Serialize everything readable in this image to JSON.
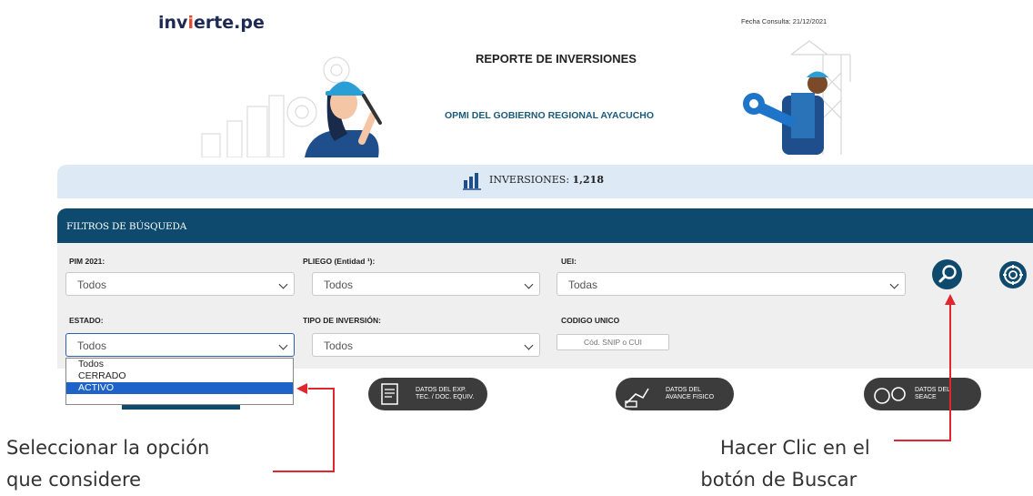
{
  "header": {
    "logo_pre": "inv",
    "logo_caret": "i",
    "logo_post": "erte.pe",
    "fecha": "Fecha Consulta: 21/12/2021",
    "title": "REPORTE DE INVERSIONES",
    "subtitle": "OPMI DEL GOBIERNO REGIONAL AYACUCHO"
  },
  "summary": {
    "label": "INVERSIONES:",
    "count": "1,218"
  },
  "filters": {
    "title": "FILTROS DE BÚSQUEDA",
    "pim": {
      "label": "PIM 2021:",
      "value": "Todos"
    },
    "pliego": {
      "label": "PLIEGO (Entidad ¹):",
      "value": "Todos"
    },
    "uei": {
      "label": "UEI:",
      "value": "Todas"
    },
    "estado": {
      "label": "ESTADO:",
      "value": "Todos",
      "options": [
        "Todos",
        "CERRADO",
        "ACTIVO"
      ],
      "highlighted": "ACTIVO"
    },
    "tipo": {
      "label": "TIPO DE INVERSIÓN:",
      "value": "Todos"
    },
    "codigo": {
      "label": "CODIGO UNICO",
      "placeholder": "Cód. SNIP o CUI"
    }
  },
  "cards": [
    {
      "line1": "DATOS DEL EXP.",
      "line2": "TEC. / DOC. EQUIV."
    },
    {
      "line1": "DATOS DEL",
      "line2": "AVANCE FISICO"
    },
    {
      "line1": "DATOS DEL",
      "line2": "SEACE"
    }
  ],
  "annotations": {
    "left_line1": "Seleccionar la opción",
    "left_line2": "que considere",
    "right_line1": "Hacer Clic en el",
    "right_line2": "botón de Buscar"
  },
  "colors": {
    "primary": "#0e4a6e",
    "banner": "#dde9f5",
    "highlight": "#1e64c8",
    "annotation": "#e0262f"
  }
}
